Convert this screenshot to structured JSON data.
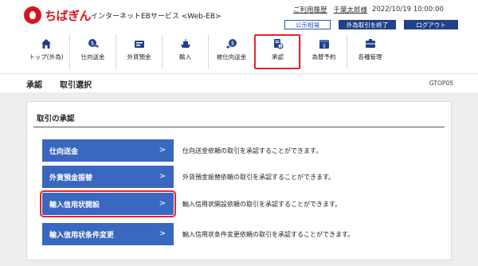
{
  "brand": {
    "logo_text": "ちばぎん",
    "service_name": "インターネットEBサービス <Web-EB>"
  },
  "util": {
    "usage_history": "ご利用履歴",
    "user_name": "千葉太郎様",
    "datetime": "2022/10/19 10:00:00"
  },
  "buttons": {
    "public_rates": "公示相場",
    "end_fx": "外為取引を終了",
    "logout": "ログアウト"
  },
  "nav": [
    {
      "label": "トップ(外為)",
      "icon": "home-icon"
    },
    {
      "label": "仕向送金",
      "icon": "remittance-icon"
    },
    {
      "label": "外貨預金",
      "icon": "deposit-icon"
    },
    {
      "label": "輸入",
      "icon": "import-ship-icon"
    },
    {
      "label": "被仕向送金",
      "icon": "inbound-remittance-icon"
    },
    {
      "label": "承認",
      "icon": "approval-icon",
      "active": true
    },
    {
      "label": "為替予約",
      "icon": "fx-contract-icon"
    },
    {
      "label": "各種管理",
      "icon": "management-icon"
    }
  ],
  "titlebar": {
    "section": "承認",
    "page": "取引選択",
    "screen_code": "GTOP05"
  },
  "panel": {
    "title": "取引の承認",
    "actions": [
      {
        "label": "仕向送金",
        "desc": "仕向送金依頼の取引を承認することができます。"
      },
      {
        "label": "外貨預金振替",
        "desc": "外貨預金振替依頼の取引を承認することができます。"
      },
      {
        "label": "輸入信用状開設",
        "desc": "輸入信用状開設依頼の取引を承認することができます。",
        "highlighted": true
      },
      {
        "label": "輸入信用状条件変更",
        "desc": "輸入信用状条件変更依頼の取引を承認することができます。"
      }
    ]
  },
  "colors": {
    "brand_red": "#d9141c",
    "nav_blue": "#23418a",
    "action_blue": "#3a67c0",
    "highlight_red": "#e3262a"
  }
}
